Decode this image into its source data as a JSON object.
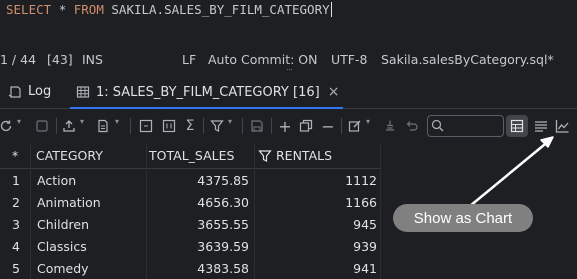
{
  "editor": {
    "sql_keyword_select": "SELECT",
    "sql_star": "*",
    "sql_keyword_from": "FROM",
    "sql_table": "SAKILA.SALES_BY_FILM_CATEGORY"
  },
  "status_bar": {
    "position": "1 / 44",
    "selection": "[43]",
    "mode": "INS",
    "line_ending": "LF",
    "auto_commit": "Auto Commit: ON",
    "encoding": "UTF-8",
    "file": "Sakila.salesByCategory.sql*"
  },
  "tabs": [
    {
      "label": "Log",
      "icon": "log-icon"
    },
    {
      "label": "1: SALES_BY_FILM_CATEGORY [16]",
      "icon": "table-icon",
      "close": "×"
    }
  ],
  "search": {
    "placeholder": ""
  },
  "table": {
    "row_marker_header": "*",
    "columns": [
      "CATEGORY",
      "TOTAL_SALES",
      "RENTALS"
    ],
    "rows": [
      {
        "n": "1",
        "category": "Action",
        "total_sales": "4375.85",
        "rentals": "1112"
      },
      {
        "n": "2",
        "category": "Animation",
        "total_sales": "4656.30",
        "rentals": "1166"
      },
      {
        "n": "3",
        "category": "Children",
        "total_sales": "3655.55",
        "rentals": "945"
      },
      {
        "n": "4",
        "category": "Classics",
        "total_sales": "3639.59",
        "rentals": "939"
      },
      {
        "n": "5",
        "category": "Comedy",
        "total_sales": "4383.58",
        "rentals": "941"
      }
    ]
  },
  "callout": {
    "label": "Show as Chart"
  },
  "colors": {
    "accent": "#3574f0",
    "background": "#1e1f22",
    "callout": "#808080"
  }
}
